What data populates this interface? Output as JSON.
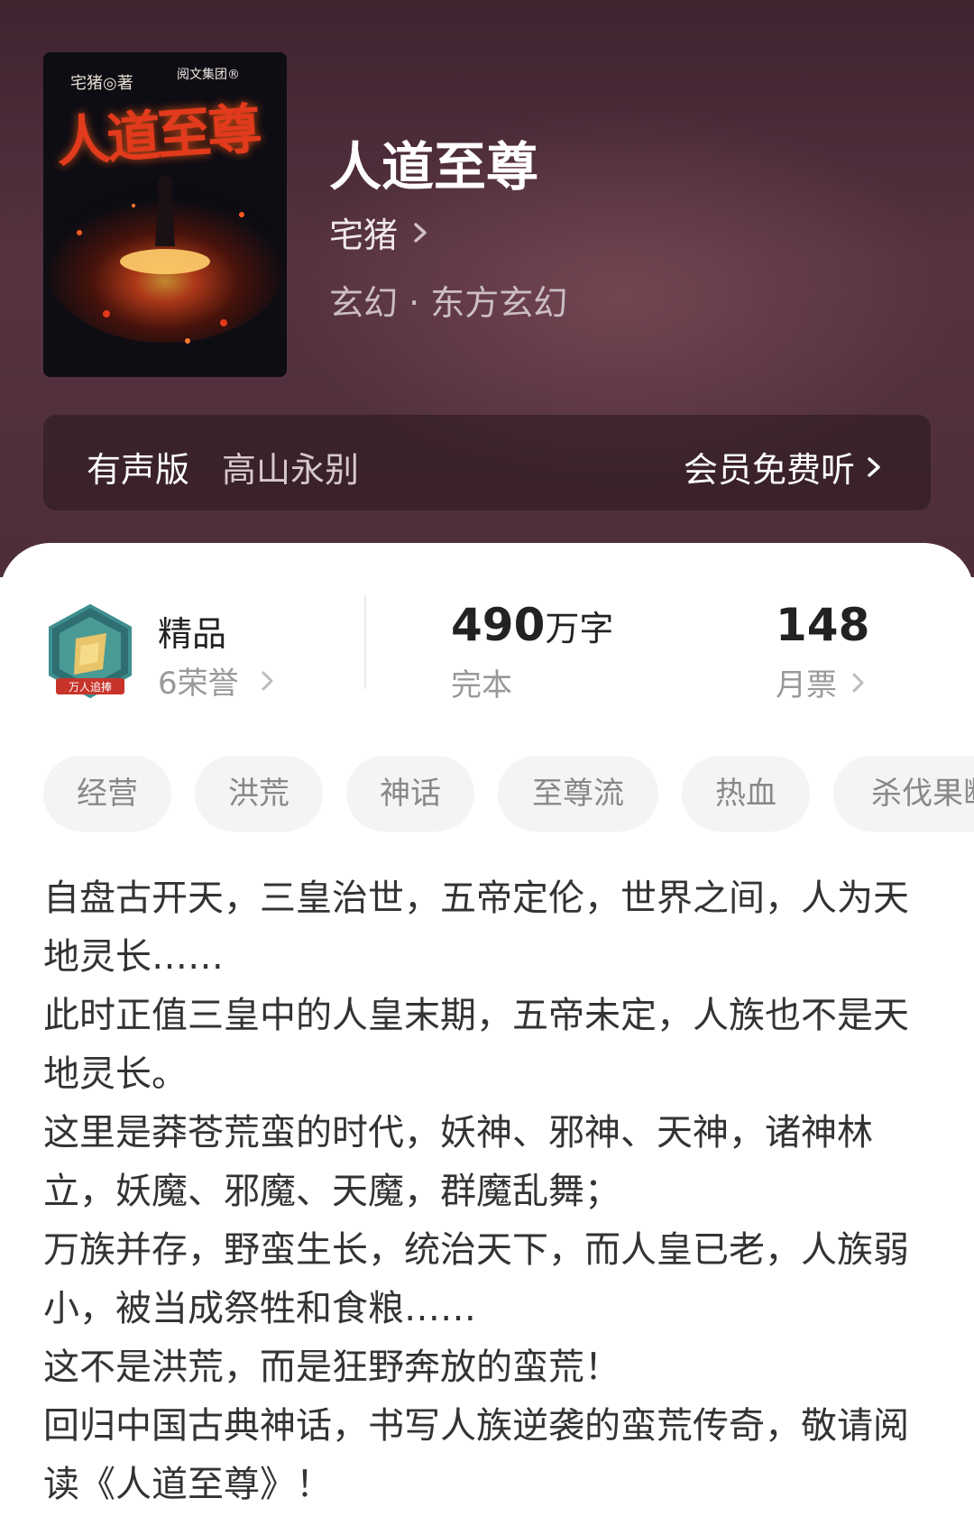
{
  "book": {
    "title": "人道至尊",
    "author": "宅猪",
    "genre": "玄幻 · 东方玄幻"
  },
  "cover": {
    "author": "宅猪◎著",
    "publisher": "阅文集团®",
    "title": "人道至尊"
  },
  "audio": {
    "label": "有声版",
    "narrator": "高山永别",
    "action": "会员免费听"
  },
  "honor": {
    "title": "精品",
    "subtitle": "6荣誉",
    "badge_text": "万人追捧"
  },
  "stats": {
    "words_number": "490",
    "words_unit": "万字",
    "status": "完本",
    "votes": "148",
    "votes_label": "月票"
  },
  "tags": [
    "经营",
    "洪荒",
    "神话",
    "至尊流",
    "热血",
    "杀伐果断"
  ],
  "description": [
    "自盘古开天，三皇治世，五帝定伦，世界之间，人为天地灵长……",
    "此时正值三皇中的人皇末期，五帝未定，人族也不是天地灵长。",
    "这里是莽苍荒蛮的时代，妖神、邪神、天神，诸神林立，妖魔、邪魔、天魔，群魔乱舞；",
    "万族并存，野蛮生长，统治天下，而人皇已老，人族弱小，被当成祭牲和食粮……",
    "这不是洪荒，而是狂野奔放的蛮荒！",
    "回归中国古典神话，书写人族逆袭的蛮荒传奇，敬请阅读《人道至尊》！"
  ]
}
